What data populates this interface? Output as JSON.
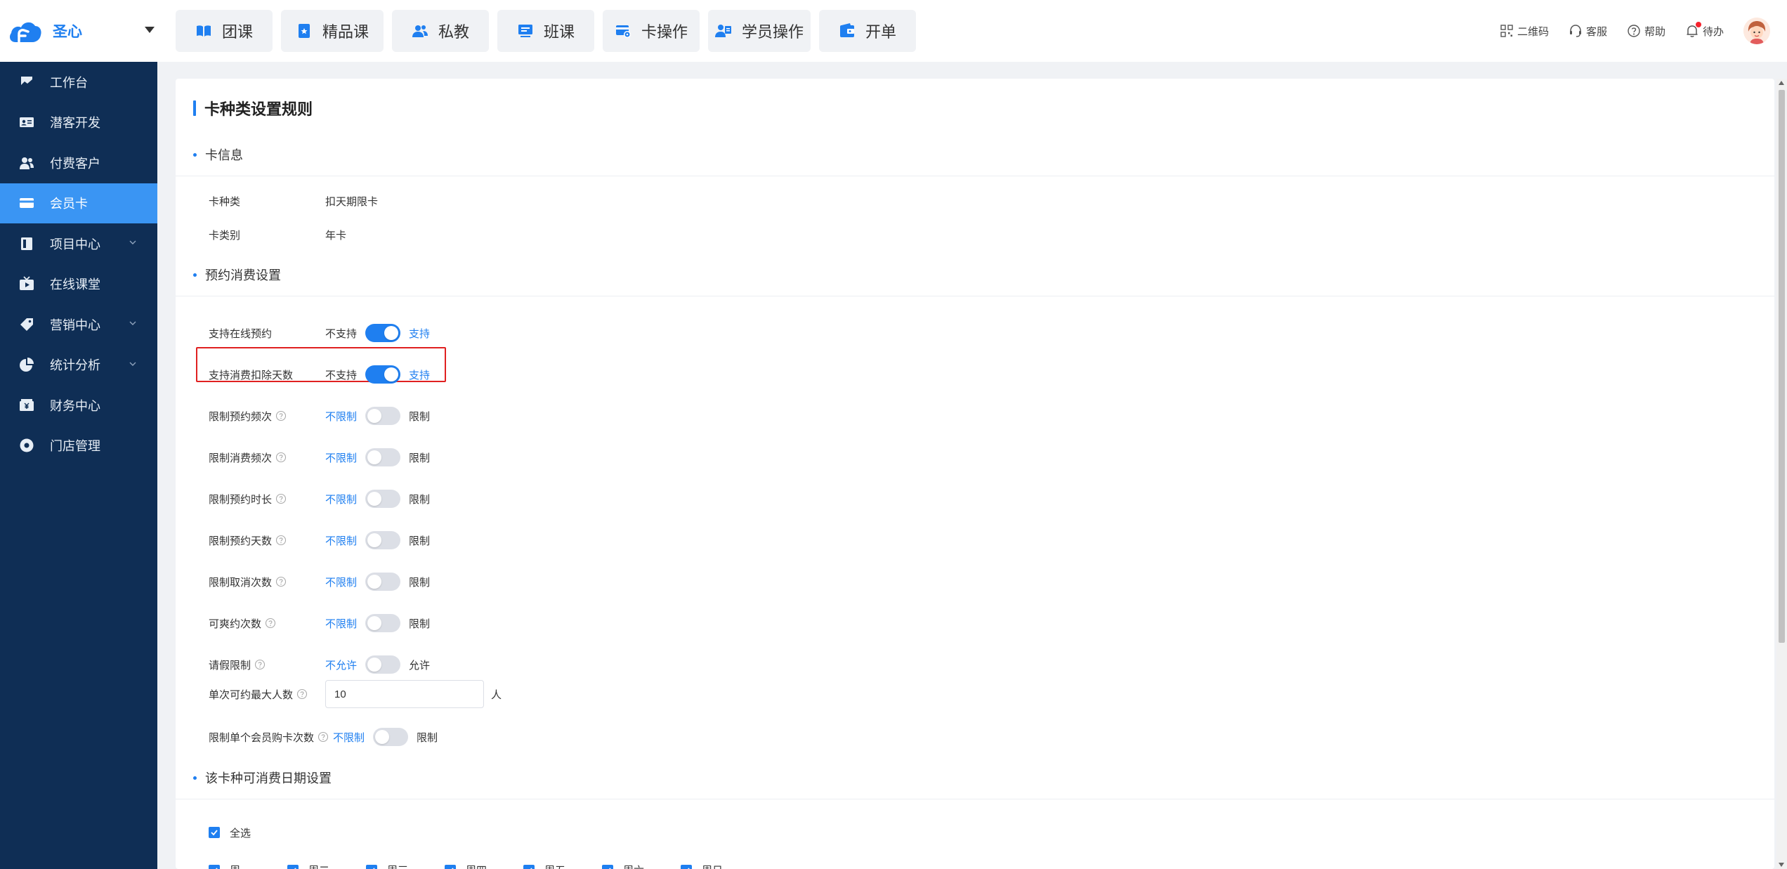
{
  "brand": {
    "name": "圣心"
  },
  "nav": [
    {
      "label": "团课",
      "icon": "book-open-icon"
    },
    {
      "label": "精品课",
      "icon": "star-book-icon"
    },
    {
      "label": "私教",
      "icon": "users-icon"
    },
    {
      "label": "班课",
      "icon": "monitor-icon"
    },
    {
      "label": "卡操作",
      "icon": "card-gear-icon"
    },
    {
      "label": "学员操作",
      "icon": "user-card-icon"
    },
    {
      "label": "开单",
      "icon": "wallet-icon"
    }
  ],
  "topright": {
    "qrcode": "二维码",
    "service": "客服",
    "help": "帮助",
    "todo": "待办"
  },
  "sidebar": [
    {
      "label": "工作台",
      "icon": "dashboard-icon",
      "active": false,
      "expandable": false
    },
    {
      "label": "潜客开发",
      "icon": "id-card-icon",
      "active": false,
      "expandable": false
    },
    {
      "label": "付费客户",
      "icon": "users-icon",
      "active": false,
      "expandable": false
    },
    {
      "label": "会员卡",
      "icon": "card-icon",
      "active": true,
      "expandable": false
    },
    {
      "label": "项目中心",
      "icon": "project-icon",
      "active": false,
      "expandable": true
    },
    {
      "label": "在线课堂",
      "icon": "tv-icon",
      "active": false,
      "expandable": false
    },
    {
      "label": "营销中心",
      "icon": "tag-icon",
      "active": false,
      "expandable": true
    },
    {
      "label": "统计分析",
      "icon": "pie-chart-icon",
      "active": false,
      "expandable": true
    },
    {
      "label": "财务中心",
      "icon": "cash-icon",
      "active": false,
      "expandable": false
    },
    {
      "label": "门店管理",
      "icon": "store-icon",
      "active": false,
      "expandable": false
    }
  ],
  "page": {
    "title": "卡种类设置规则",
    "section_card_info": "卡信息",
    "card_type_label": "卡种类",
    "card_type_value": "扣天期限卡",
    "card_category_label": "卡类别",
    "card_category_value": "年卡",
    "section_booking": "预约消费设置",
    "section_dates": "该卡种可消费日期设置",
    "settings": [
      {
        "label": "支持在线预约",
        "help": false,
        "off": "不支持",
        "on": "支持",
        "enabled": true
      },
      {
        "label": "支持消费扣除天数",
        "help": false,
        "off": "不支持",
        "on": "支持",
        "enabled": true
      },
      {
        "label": "限制预约频次",
        "help": true,
        "off": "不限制",
        "on": "限制",
        "enabled": false
      },
      {
        "label": "限制消费频次",
        "help": true,
        "off": "不限制",
        "on": "限制",
        "enabled": false
      },
      {
        "label": "限制预约时长",
        "help": true,
        "off": "不限制",
        "on": "限制",
        "enabled": false
      },
      {
        "label": "限制预约天数",
        "help": true,
        "off": "不限制",
        "on": "限制",
        "enabled": false
      },
      {
        "label": "限制取消次数",
        "help": true,
        "off": "不限制",
        "on": "限制",
        "enabled": false
      },
      {
        "label": "可爽约次数",
        "help": true,
        "off": "不限制",
        "on": "限制",
        "enabled": false
      },
      {
        "label": "请假限制",
        "help": true,
        "off": "不允许",
        "on": "允许",
        "enabled": false
      }
    ],
    "max_people_label": "单次可约最大人数",
    "max_people_value": "10",
    "max_people_unit": "人",
    "limit_purchase_label": "限制单个会员购卡次数",
    "limit_purchase_off": "不限制",
    "limit_purchase_on": "限制",
    "select_all": "全选",
    "weekdays": [
      "周一",
      "周二",
      "周三",
      "周四",
      "周五",
      "周六",
      "周日"
    ]
  }
}
